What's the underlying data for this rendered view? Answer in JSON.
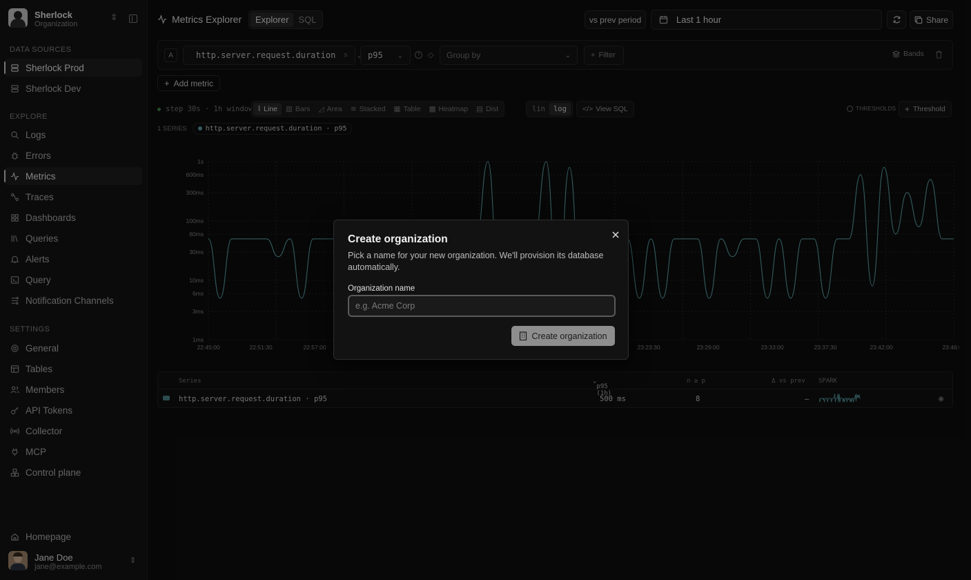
{
  "org": {
    "name": "Sherlock",
    "subtitle": "Organization"
  },
  "sidebar": {
    "sections": {
      "data_sources": "DATA SOURCES",
      "explore": "EXPLORE",
      "settings": "SETTINGS"
    },
    "data_sources": [
      {
        "label": "Sherlock Prod",
        "icon": "database-icon",
        "active": true
      },
      {
        "label": "Sherlock Dev",
        "icon": "database-icon",
        "active": false
      }
    ],
    "explore": [
      {
        "label": "Logs",
        "icon": "search-icon"
      },
      {
        "label": "Errors",
        "icon": "bug-icon"
      },
      {
        "label": "Metrics",
        "icon": "activity-icon",
        "active": true
      },
      {
        "label": "Traces",
        "icon": "traces-icon"
      },
      {
        "label": "Dashboards",
        "icon": "grid-icon"
      },
      {
        "label": "Queries",
        "icon": "library-icon"
      },
      {
        "label": "Alerts",
        "icon": "bell-icon"
      },
      {
        "label": "Query",
        "icon": "terminal-icon"
      },
      {
        "label": "Notification Channels",
        "icon": "channels-icon"
      }
    ],
    "settings": [
      {
        "label": "General",
        "icon": "gear-icon"
      },
      {
        "label": "Tables",
        "icon": "table-icon"
      },
      {
        "label": "Members",
        "icon": "users-icon"
      },
      {
        "label": "API Tokens",
        "icon": "key-icon"
      },
      {
        "label": "Collector",
        "icon": "radio-icon"
      },
      {
        "label": "MCP",
        "icon": "plug-icon"
      },
      {
        "label": "Control plane",
        "icon": "boxes-icon"
      }
    ],
    "homepage": "Homepage"
  },
  "user": {
    "name": "Jane Doe",
    "email": "jane@example.com"
  },
  "header": {
    "title": "Metrics Explorer",
    "tabs": [
      "Explorer",
      "SQL"
    ],
    "compare": "vs prev period",
    "time_range": "Last 1 hour",
    "share": "Share"
  },
  "query": {
    "letter": "A",
    "metric": "http.server.request.duration",
    "unit": "s",
    "aggregation": "p95",
    "group_by_placeholder": "Group by",
    "filter": "Filter",
    "bands": "Bands"
  },
  "add_metric": "Add metric",
  "toolbar": {
    "step": "step 30s · 1h window",
    "chart_types": [
      "Line",
      "Bars",
      "Area",
      "Stacked",
      "Table",
      "Heatmap",
      "Dist"
    ],
    "scales": [
      "lin",
      "log"
    ],
    "view_sql": "View SQL",
    "thresholds": "THRESHOLDS",
    "threshold": "Threshold"
  },
  "series_info": {
    "count_label": "1 SERIES",
    "name": "http.server.request.duration · p95"
  },
  "chart_data": {
    "type": "line",
    "scale": "log",
    "y_ticks": [
      "1s",
      "600ms",
      "300ms",
      "100ms",
      "60ms",
      "30ms",
      "10ms",
      "6ms",
      "3ms",
      "1ms"
    ],
    "x_ticks": [
      "22:45:00",
      "22:51:30",
      "22:57:00",
      "23:23:30",
      "23:29:00",
      "23:33:00",
      "23:37:30",
      "23:42:00",
      "23:46:00"
    ],
    "series": [
      {
        "name": "http.server.request.duration · p95",
        "color": "#5fa9b0",
        "values_ms": [
          50,
          5,
          50,
          50,
          50,
          50,
          25,
          50,
          5,
          50,
          50,
          50,
          50,
          5,
          50,
          50,
          50,
          50,
          50,
          5,
          50,
          50,
          50,
          50,
          1000,
          5,
          50,
          50,
          50,
          1000,
          5,
          800,
          5,
          50,
          80,
          50,
          50,
          5,
          50,
          5,
          50,
          50,
          50,
          5,
          50,
          25,
          50,
          50,
          5,
          50,
          5,
          50,
          50,
          5,
          50,
          50,
          600,
          8,
          800,
          60,
          300,
          80,
          500,
          50,
          50
        ]
      }
    ]
  },
  "table": {
    "headers": {
      "series": "Series",
      "p95": "p95 (1h)",
      "n": "n ≥ p",
      "delta": "Δ vs prev",
      "spark": "SPARK"
    },
    "rows": [
      {
        "series": "http.server.request.duration · p95",
        "p95": "500 ms",
        "n": "8",
        "delta": "—"
      }
    ]
  },
  "modal": {
    "title": "Create organization",
    "description": "Pick a name for your new organization. We'll provision its database automatically.",
    "field_label": "Organization name",
    "placeholder": "e.g. Acme Corp",
    "submit": "Create organization"
  }
}
